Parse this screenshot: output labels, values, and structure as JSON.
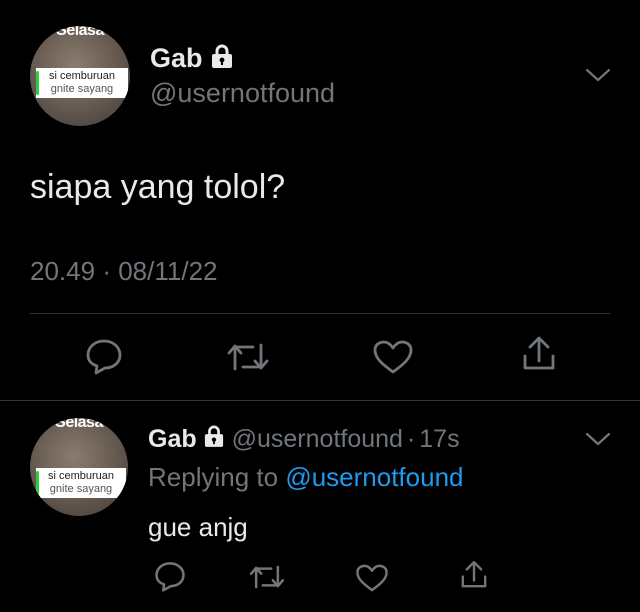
{
  "main_tweet": {
    "avatar": {
      "top_text": "Selasa",
      "bubble_line1": "si cemburuan",
      "bubble_line2": "gnite sayang"
    },
    "display_name": "Gab",
    "handle": "@usernotfound",
    "text": "siapa yang tolol?",
    "time": "20.49",
    "separator": "·",
    "date": "08/11/22"
  },
  "reply_tweet": {
    "avatar": {
      "top_text": "Selasa",
      "bubble_line1": "si cemburuan",
      "bubble_line2": "gnite sayang"
    },
    "display_name": "Gab",
    "handle": "@usernotfound",
    "separator": "·",
    "age": "17s",
    "replying_prefix": "Replying to",
    "replying_handle": "@usernotfound",
    "text": "gue anjg"
  },
  "colors": {
    "background": "#000000",
    "text_primary": "#e7e9ea",
    "text_secondary": "#71767b",
    "link": "#1d9bf0",
    "divider": "#2f3336"
  },
  "icons": [
    "lock-icon",
    "chevron-down-icon",
    "reply-icon",
    "retweet-icon",
    "like-icon",
    "share-icon"
  ]
}
